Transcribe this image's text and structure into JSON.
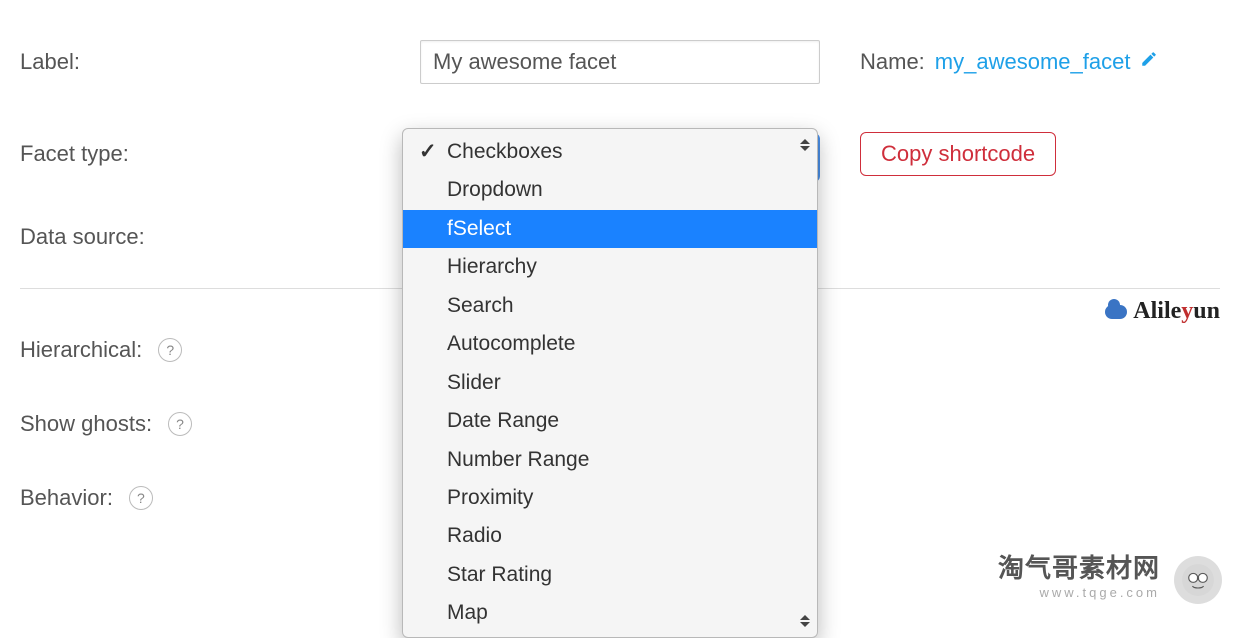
{
  "rows": {
    "label_field": {
      "label": "Label:",
      "value": "My awesome facet"
    },
    "name_field": {
      "label": "Name:",
      "value": "my_awesome_facet"
    },
    "facet_type": {
      "label": "Facet type:"
    },
    "data_source": {
      "label": "Data source:"
    },
    "hierarchical": {
      "label": "Hierarchical:"
    },
    "show_ghosts": {
      "label": "Show ghosts:"
    },
    "behavior": {
      "label": "Behavior:"
    }
  },
  "copy_shortcode": "Copy shortcode",
  "dropdown": {
    "selected": "Checkboxes",
    "highlighted": "fSelect",
    "options": [
      "Checkboxes",
      "Dropdown",
      "fSelect",
      "Hierarchy",
      "Search",
      "Autocomplete",
      "Slider",
      "Date Range",
      "Number Range",
      "Proximity",
      "Radio",
      "Star Rating",
      "Map"
    ]
  },
  "watermarks": {
    "alileyun": "Alileyun",
    "tqge_ch": "淘气哥素材网",
    "tqge_url": "www.tqge.com"
  }
}
